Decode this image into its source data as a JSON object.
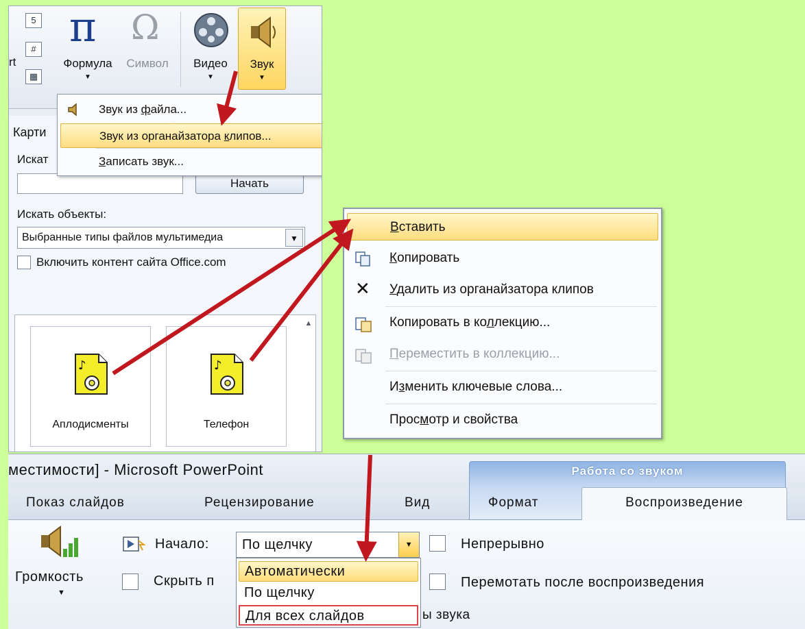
{
  "ribbon": {
    "partial_label": "rt",
    "formula_label": "Формула",
    "symbol_label": "Символ",
    "video_label": "Видео",
    "sound_label": "Звук",
    "small_icon_2": "#"
  },
  "sound_menu": {
    "items": [
      {
        "pre": "Звук из ",
        "u": "ф",
        "post": "айла...",
        "icon": "speaker-icon"
      },
      {
        "pre": "Звук из органайзатора ",
        "u": "к",
        "post": "липов..."
      },
      {
        "pre": "",
        "u": "З",
        "post": "аписать звук..."
      }
    ]
  },
  "task_pane": {
    "title": "Карти",
    "search_label": "Искат",
    "search_value": "",
    "start_button": "Начать",
    "types_label": "Искать объекты:",
    "types_value": "Выбранные типы файлов мультимедиа",
    "office_label": "Включить контент сайта Office.com",
    "clips": [
      "Аплодисменты",
      "Телефон"
    ]
  },
  "context_menu": {
    "items": [
      {
        "pre": "",
        "u": "В",
        "post": "ставить"
      },
      {
        "pre": "",
        "u": "К",
        "post": "опировать"
      },
      {
        "pre": "",
        "u": "У",
        "post": "далить из органайзатора клипов"
      },
      {
        "pre": "Копировать в ко",
        "u": "л",
        "post": "лекцию..."
      },
      {
        "pre": "",
        "u": "П",
        "post": "ереместить в коллекцию..."
      },
      {
        "pre": "И",
        "u": "з",
        "post": "менить ключевые слова..."
      },
      {
        "pre": "Прос",
        "u": "м",
        "post": "отр и свойства"
      }
    ]
  },
  "playback": {
    "window_title": "местимости] - Microsoft PowerPoint",
    "context_group": "Работа со звуком",
    "tabs": {
      "slideshow": "Показ слайдов",
      "review": "Рецензирование",
      "view": "Вид",
      "format": "Формат",
      "playback": "Воспроизведение"
    },
    "volume_label": "Громкость",
    "start_label": "Начало:",
    "start_value": "По щелчку",
    "start_options": [
      "Автоматически",
      "По щелчку",
      "Для всех слайдов"
    ],
    "hide_label": "Скрыть п",
    "loop_label": "Непрерывно",
    "rewind_label": "Перемотать после воспроизведения",
    "partial_group": "ы звука"
  },
  "colors": {
    "background": "#ccff99",
    "highlight": "#ffdd80",
    "arrow": "#c0181e"
  }
}
